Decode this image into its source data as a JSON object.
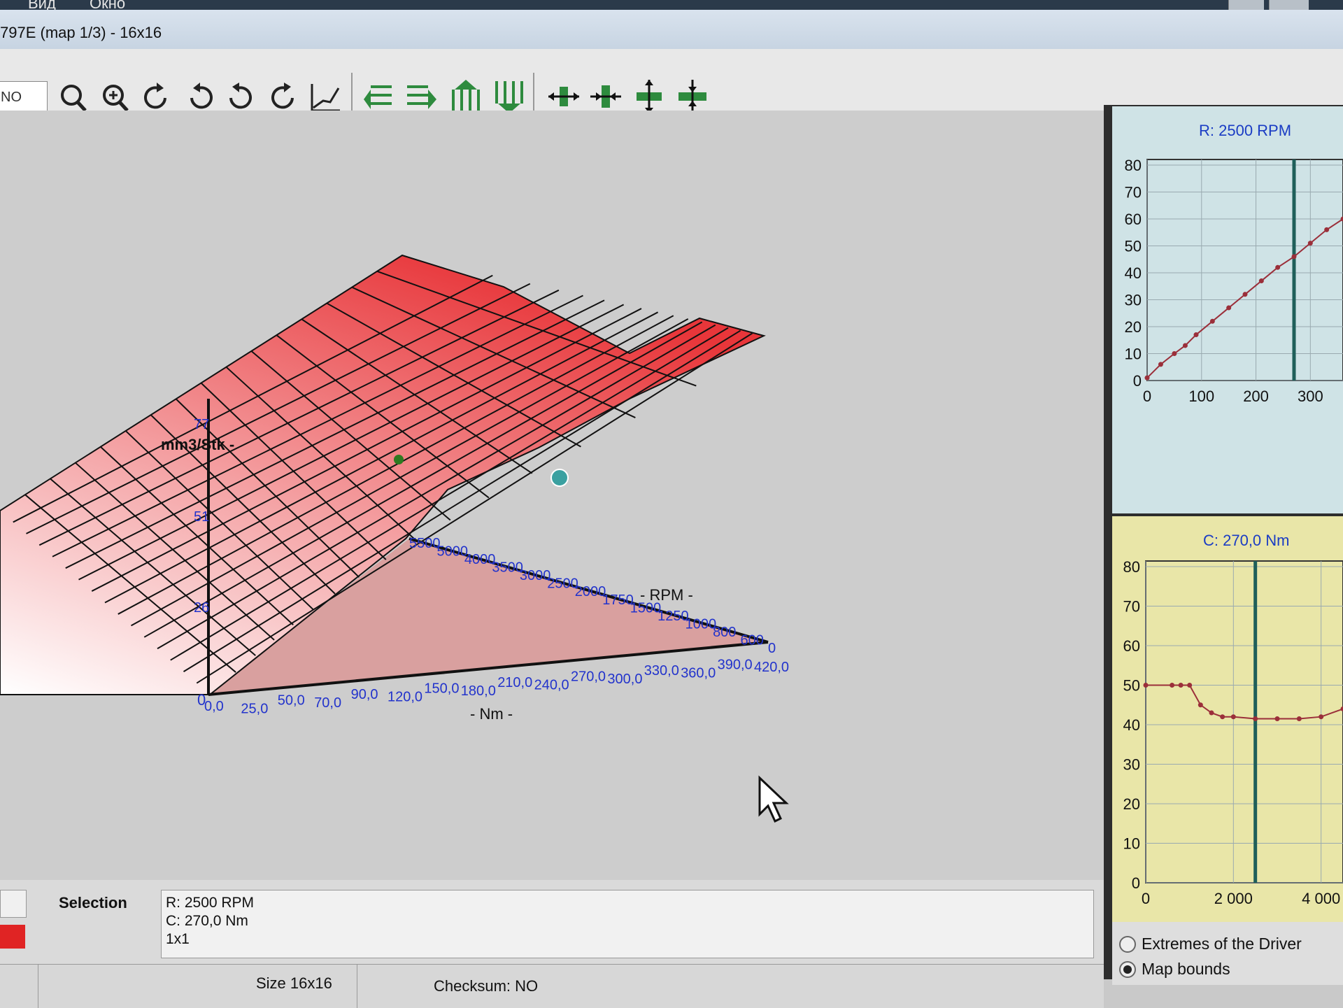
{
  "menu": {
    "item1": "Вид",
    "item2": "Окно"
  },
  "window": {
    "title": "797E (map 1/3) - 16x16"
  },
  "toolbar": {
    "no_field": "NO"
  },
  "graph3d": {
    "z_axis_label": "mm3/Stk -",
    "z_ticks": [
      "77",
      "51",
      "26"
    ],
    "rpm_axis_label": "- RPM -",
    "rpm_ticks": [
      "5500",
      "5000",
      "4000",
      "3500",
      "3000",
      "2500",
      "2000",
      "1750",
      "1500",
      "1250",
      "1000",
      "800",
      "600",
      "0"
    ],
    "nm_axis_label": "- Nm -",
    "nm_ticks": [
      "0,0",
      "25,0",
      "50,0",
      "70,0",
      "90,0",
      "120,0",
      "150,0",
      "180,0",
      "210,0",
      "240,0",
      "270,0",
      "300,0",
      "330,0",
      "360,0",
      "390,0",
      "420,0"
    ],
    "origin_label": "0",
    "surface_color": "#e8363a"
  },
  "panel_rpm": {
    "title": "R: 2500 RPM",
    "y_ticks": [
      "80",
      "70",
      "60",
      "50",
      "40",
      "30",
      "20",
      "10",
      "0"
    ],
    "x_ticks": [
      "0",
      "100",
      "200",
      "300"
    ]
  },
  "panel_nm": {
    "title": "C: 270,0 Nm",
    "y_ticks": [
      "80",
      "70",
      "60",
      "50",
      "40",
      "30",
      "20",
      "10",
      "0"
    ],
    "x_ticks": [
      "0",
      "2 000",
      "4 000"
    ]
  },
  "chart_data": [
    {
      "type": "line",
      "title": "R: 2500 RPM",
      "x_ticks": [
        0,
        100,
        200,
        300
      ],
      "xlim": [
        0,
        360
      ],
      "ylim": [
        0,
        80
      ],
      "x": [
        0,
        25,
        50,
        70,
        90,
        120,
        150,
        180,
        210,
        240,
        270,
        300,
        330,
        360
      ],
      "values": [
        1,
        6,
        10,
        13,
        17,
        22,
        27,
        32,
        37,
        42,
        46,
        51,
        56,
        60
      ],
      "marker_x": 270
    },
    {
      "type": "line",
      "title": "C: 270,0 Nm",
      "x_ticks": [
        0,
        2000,
        4000
      ],
      "xlim": [
        0,
        4500
      ],
      "ylim": [
        0,
        80
      ],
      "x": [
        0,
        600,
        800,
        1000,
        1250,
        1500,
        1750,
        2000,
        2500,
        3000,
        3500,
        4000,
        4500
      ],
      "values": [
        50,
        50,
        50,
        50,
        45,
        43,
        42,
        42,
        41.5,
        41.5,
        41.5,
        42,
        44
      ],
      "marker_x": 2500
    }
  ],
  "selection": {
    "label": "Selection",
    "line1": "R: 2500 RPM",
    "line2": "C: 270,0 Nm",
    "line3": "1x1"
  },
  "radio": {
    "opt1": "Extremes of the Driver",
    "opt2": "Map bounds",
    "selected": "Map bounds"
  },
  "status": {
    "size": "Size 16x16",
    "checksum": "Checksum: NO"
  }
}
